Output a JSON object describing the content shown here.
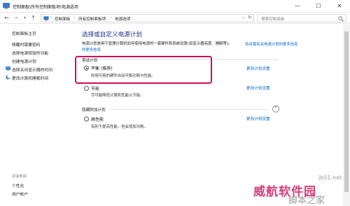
{
  "window": {
    "title": "控制面板\\所有控制面板项\\电源选项",
    "minimize": "—",
    "maximize": "☐",
    "close": "✕"
  },
  "address": {
    "back": "←",
    "forward": "→",
    "up": "↑",
    "crumbs": [
      "控制面板",
      "所有控制面板项",
      "电源选项"
    ],
    "search_placeholder": "搜索控制面板"
  },
  "sidebar": {
    "home": "控制面板主页",
    "links": [
      "唤醒时需要密码",
      "选择电源按钮的功能",
      "创建电源计划",
      "选择关闭显示器的时间",
      "更改计算机睡眠时间"
    ],
    "see_also": "另请参阅",
    "bottom_links": [
      "个性化",
      "用户帐户"
    ]
  },
  "main": {
    "heading": "选择或自定义电源计划",
    "description": "电源计划是用于管理计算机如何使用电源的一套硬件和系统设置(如显示器亮度、睡眠等)。",
    "desc_link": "告诉我有关电源计划的更多信息",
    "desc_link2": "的更多信息",
    "preferred_label": "首选计划",
    "plans": [
      {
        "name": "平衡 (推荐)",
        "desc": "利用可用的硬件自动平衡功耗与性能。",
        "link": "更改计划设置",
        "selected": true
      },
      {
        "name": "节能",
        "desc": "尽可能降低计算机性能以节能。",
        "link": "更改计划设置",
        "selected": false
      }
    ],
    "hidden_label": "隐藏附加计划",
    "hidden_plans": [
      {
        "name": "高性能",
        "desc": "有利于提高性能，但会增加功耗。",
        "link": "更改计划设置",
        "selected": false
      }
    ],
    "expander": "^"
  },
  "watermark": {
    "line1": "威航软件园",
    "line2": "jb51.net",
    "line3": "脚本之家"
  },
  "colors": {
    "highlight": "#d10a5a",
    "link": "#0066cc",
    "heading": "#1e3287"
  }
}
